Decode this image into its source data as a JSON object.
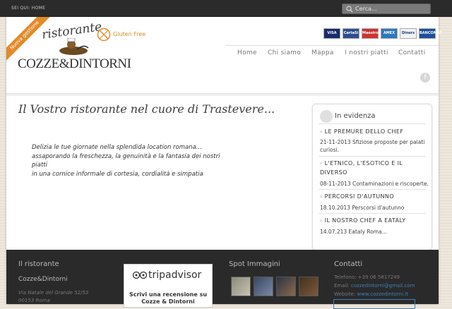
{
  "topbar": {
    "breadcrumb": "SEI QUI: HOME",
    "search_placeholder": "Cerca..."
  },
  "header": {
    "ribbon": "Nuova gestione",
    "logo_script": "ristorante",
    "logo_name": "COZZE&DINTORNI",
    "gluten_free": "Gluten Free",
    "cards": [
      "VISA",
      "CartaSi",
      "Maestro",
      "AMEX",
      "Diners",
      "BANCOMAT"
    ]
  },
  "nav": {
    "items": [
      "Home",
      "Chi siamo",
      "Mappa",
      "I nostri piatti",
      "Contatti"
    ]
  },
  "hero": {
    "title": "Il Vostro ristorante nel cuore di Trastevere...",
    "intro_line1": "Delizia le tue giornate nella splendida location romana...",
    "intro_line2": "assaporando la freschezza, la genuinità e la fantasia dei nostri piatti",
    "intro_line3": "in una cornice informale di cortesia, cordialità e simpatia"
  },
  "evidenza": {
    "title": "In evidenza",
    "items": [
      {
        "title": "LE PREMURE DELLO CHEF",
        "text": "21-11-2013 Sfiziose proposte per palati curiosi."
      },
      {
        "title": "L'ETNICO, L'ESOTICO E IL DIVERSO",
        "text": "08-11-2013 Contaminazioni e riscoperte."
      },
      {
        "title": "PERCORSI D'AUTUNNO",
        "text": "18.10.2013 Perscorsi d'autunno"
      },
      {
        "title": "IL NOSTRO CHEF A EATALY",
        "text": "14.07.213 Eataly Roma..."
      }
    ]
  },
  "footer": {
    "col1_head": "Il ristorante",
    "col1_name": "Cozze&Dintorni",
    "col1_address1": "Via Natale del Grande 52/53",
    "col1_address2": "00153 Roma",
    "tripadvisor_logo": "tripadvisor",
    "tripadvisor_text": "Scrivi una recensione su Cozze & Dintorni",
    "col3_head": "Spot Immagini",
    "col4_head": "Contatti",
    "phone": "Telefono: +39 06 5817249",
    "email_label": "Email:",
    "email": "cozzedintorni@gmail.com",
    "website_label": "Website:",
    "website": "www.cozzedintorni.it"
  },
  "colors": {
    "accent_orange": "#e28a28",
    "topbar": "#2b2b2b",
    "footer": "#2a2a2a",
    "link_blue": "#3f7fb8",
    "tripadvisor_green": "#589442"
  }
}
